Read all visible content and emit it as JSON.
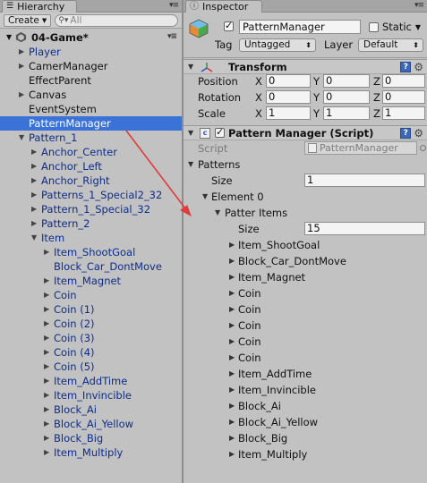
{
  "hierarchy": {
    "tab_label": "Hierarchy",
    "create_label": "Create",
    "search_placeholder": "All",
    "scene_name": "04-Game*",
    "items": [
      {
        "label": "Player",
        "arrow": "right",
        "blue": true
      },
      {
        "label": "CamerManager",
        "arrow": "right",
        "blue": false
      },
      {
        "label": "EffectParent",
        "arrow": "none",
        "blue": false
      },
      {
        "label": "Canvas",
        "arrow": "right",
        "blue": false
      },
      {
        "label": "EventSystem",
        "arrow": "none",
        "blue": false
      },
      {
        "label": "PatternManager",
        "arrow": "none",
        "selected": true
      },
      {
        "label": "Pattern_1",
        "arrow": "down",
        "blue": true
      },
      {
        "label": "Anchor_Center",
        "arrow": "right",
        "blue": true
      },
      {
        "label": "Anchor_Left",
        "arrow": "right",
        "blue": true
      },
      {
        "label": "Anchor_Right",
        "arrow": "right",
        "blue": true
      },
      {
        "label": "Patterns_1_Special2_32",
        "arrow": "right",
        "blue": true
      },
      {
        "label": "Pattern_1_Special_32",
        "arrow": "right",
        "blue": true
      },
      {
        "label": "Pattern_2",
        "arrow": "right",
        "blue": true
      },
      {
        "label": "Item",
        "arrow": "down",
        "blue": true
      },
      {
        "label": "Item_ShootGoal",
        "arrow": "right",
        "blue": true
      },
      {
        "label": "Block_Car_DontMove",
        "arrow": "none",
        "blue": true
      },
      {
        "label": "Item_Magnet",
        "arrow": "right",
        "blue": true
      },
      {
        "label": "Coin",
        "arrow": "right",
        "blue": true
      },
      {
        "label": "Coin (1)",
        "arrow": "right",
        "blue": true
      },
      {
        "label": "Coin (2)",
        "arrow": "right",
        "blue": true
      },
      {
        "label": "Coin (3)",
        "arrow": "right",
        "blue": true
      },
      {
        "label": "Coin (4)",
        "arrow": "right",
        "blue": true
      },
      {
        "label": "Coin (5)",
        "arrow": "right",
        "blue": true
      },
      {
        "label": "Item_AddTime",
        "arrow": "right",
        "blue": true
      },
      {
        "label": "Item_Invincible",
        "arrow": "right",
        "blue": true
      },
      {
        "label": "Block_Ai",
        "arrow": "right",
        "blue": true
      },
      {
        "label": "Block_Ai_Yellow",
        "arrow": "right",
        "blue": true
      },
      {
        "label": "Block_Big",
        "arrow": "right",
        "blue": true
      },
      {
        "label": "Item_Multiply",
        "arrow": "right",
        "blue": true
      }
    ]
  },
  "inspector": {
    "tab_label": "Inspector",
    "object_name": "PatternManager",
    "active": true,
    "static_label": "Static",
    "static_checked": false,
    "tag_label": "Tag",
    "tag_value": "Untagged",
    "layer_label": "Layer",
    "layer_value": "Default",
    "transform": {
      "title": "Transform",
      "position_label": "Position",
      "rotation_label": "Rotation",
      "scale_label": "Scale",
      "axis_x": "X",
      "axis_y": "Y",
      "axis_z": "Z",
      "position": [
        "0",
        "0",
        "0"
      ],
      "rotation": [
        "0",
        "0",
        "0"
      ],
      "scale": [
        "1",
        "1",
        "1"
      ]
    },
    "script_component": {
      "title": "Pattern Manager (Script)",
      "enabled": true,
      "script_label": "Script",
      "script_value": "PatternManager",
      "patterns_label": "Patterns",
      "size_label": "Size",
      "patterns_size": "1",
      "element_label": "Element 0",
      "patter_items_label": "Patter Items",
      "items_size": "15",
      "items": [
        "Item_ShootGoal",
        "Block_Car_DontMove",
        "Item_Magnet",
        "Coin",
        "Coin",
        "Coin",
        "Coin",
        "Coin",
        "Item_AddTime",
        "Item_Invincible",
        "Block_Ai",
        "Block_Ai_Yellow",
        "Block_Big",
        "Item_Multiply"
      ]
    }
  },
  "colors": {
    "selection": "#3a72d8",
    "prefab_blue": "#0d2d8c",
    "annotation_arrow": "#e33a3a"
  }
}
